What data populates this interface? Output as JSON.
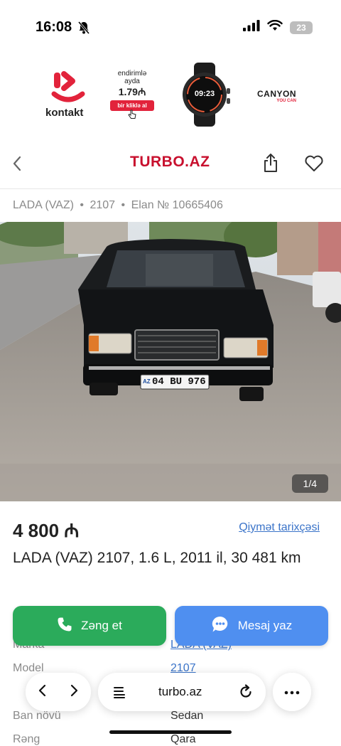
{
  "status": {
    "time": "16:08",
    "battery": "23"
  },
  "ad": {
    "brand_name": "kontakt",
    "promo_line1": "endirimlə",
    "promo_line2": "ayda",
    "promo_price": "1.79₼",
    "promo_cta": "bir kliklə al",
    "watch_time": "09:23",
    "partner_name": "CANYON",
    "partner_tagline": "YOU CAN"
  },
  "header": {
    "logo": "TURBO.AZ"
  },
  "breadcrumb": {
    "make": "LADA (VAZ)",
    "model": "2107",
    "listing": "Elan № 10665406"
  },
  "photo": {
    "counter": "1/4",
    "plate": "04 BU 976",
    "plate_country": "AZ"
  },
  "listing": {
    "price": "4 800 ₼",
    "price_history_link": "Qiymət tarixçəsi",
    "title": "LADA (VAZ) 2107, 1.6 L, 2011 il, 30 481 km"
  },
  "specs": [
    {
      "label": "Marka",
      "value": "LADA (VAZ)",
      "is_link": true
    },
    {
      "label": "Model",
      "value": "2107",
      "is_link": true
    },
    {
      "label": "Ban növü",
      "value": "Sedan",
      "is_link": false
    },
    {
      "label": "Rəng",
      "value": "Qara",
      "is_link": false
    }
  ],
  "actions": {
    "call_label": "Zəng et",
    "message_label": "Mesaj yaz"
  },
  "browser": {
    "url": "turbo.az"
  },
  "colors": {
    "brand_red": "#c8102e",
    "call_green": "#2bab5b",
    "message_blue": "#4f8ff0",
    "link_blue": "#3b74c9"
  }
}
